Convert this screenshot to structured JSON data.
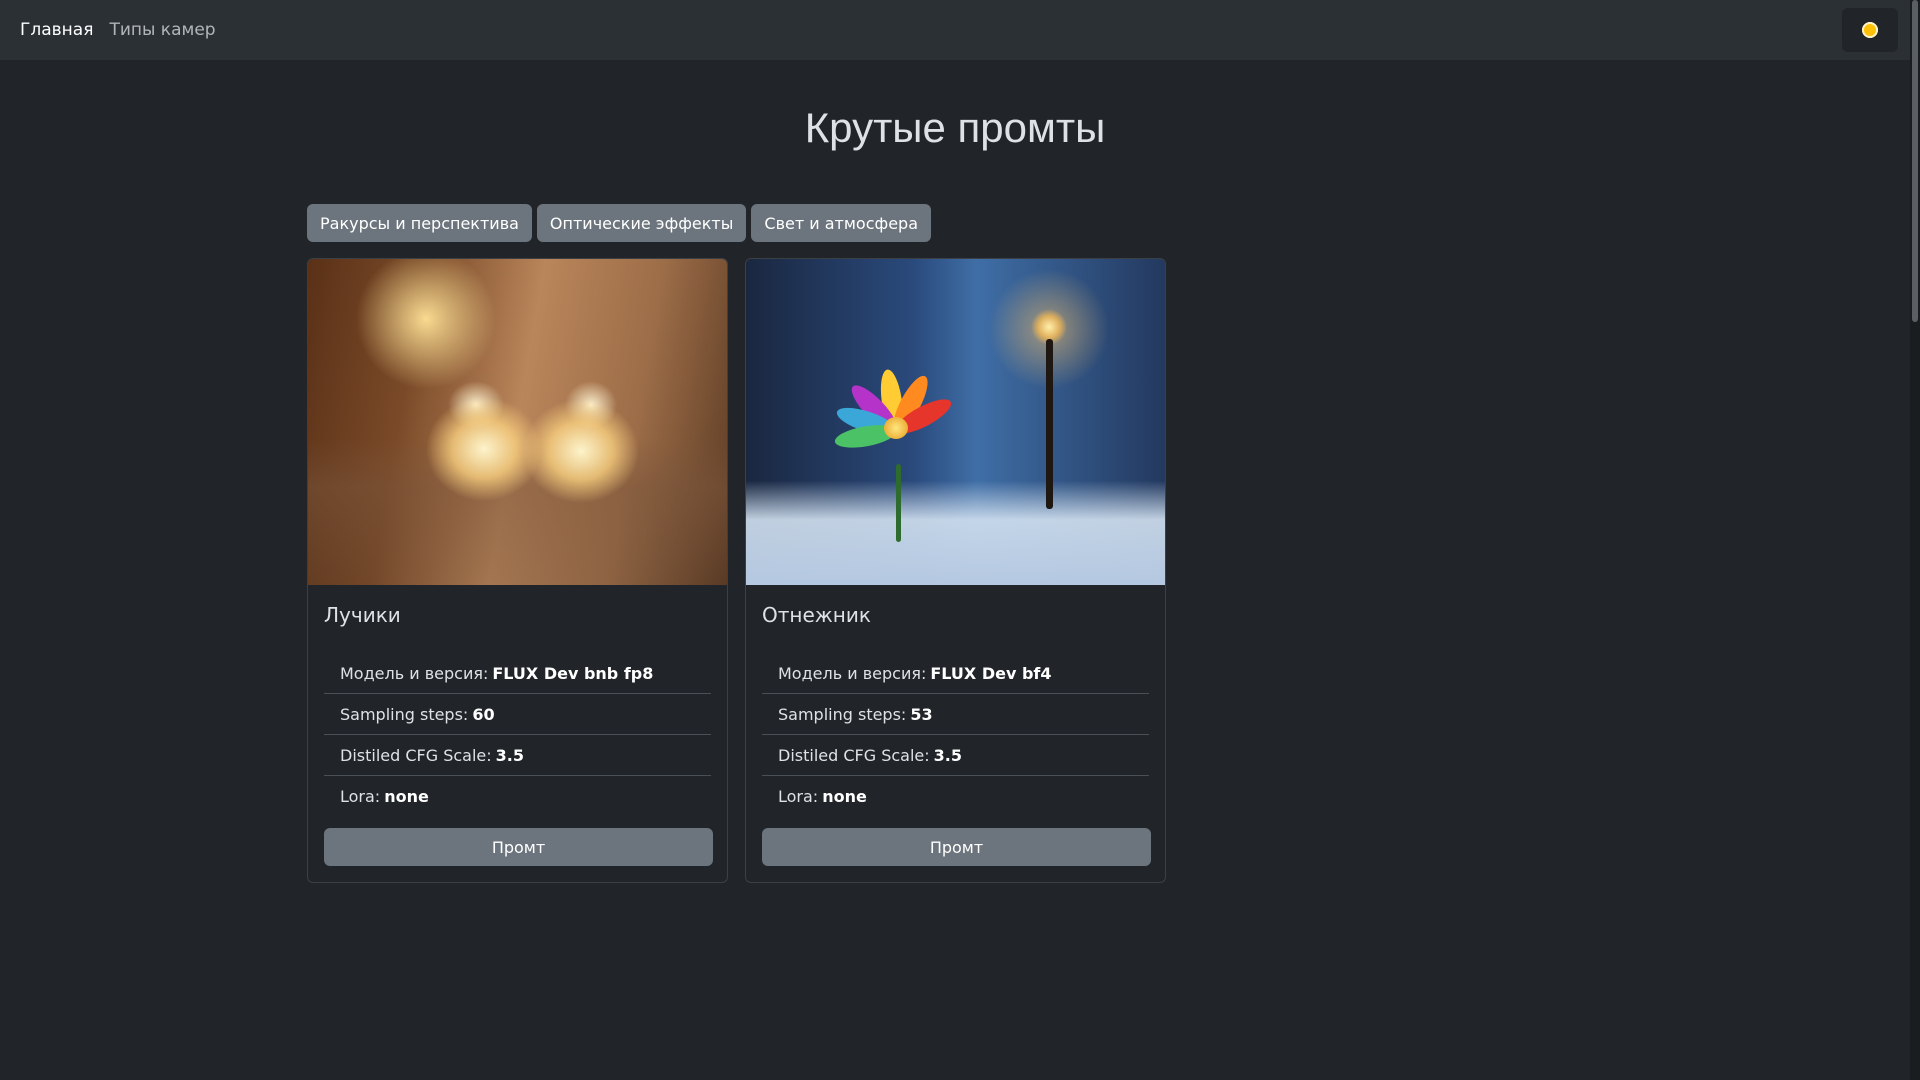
{
  "nav": {
    "home": "Главная",
    "camera_types": "Типы камер"
  },
  "title": "Крутые промты",
  "filters": [
    "Ракурсы и перспектива",
    "Оптические эффекты",
    "Свет и атмосфера"
  ],
  "cards": [
    {
      "title": "Лучики",
      "params": [
        {
          "label": "Модель и версия:",
          "value": "FLUX Dev bnb fp8"
        },
        {
          "label": "Sampling steps:",
          "value": "60"
        },
        {
          "label": "Distiled CFG Scale:",
          "value": "3.5"
        },
        {
          "label": "Lora:",
          "value": "none"
        }
      ],
      "button": "Промт"
    },
    {
      "title": "Отнежник",
      "params": [
        {
          "label": "Модель и версия:",
          "value": "FLUX Dev bf4"
        },
        {
          "label": "Sampling steps:",
          "value": "53"
        },
        {
          "label": "Distiled CFG Scale:",
          "value": "3.5"
        },
        {
          "label": "Lora:",
          "value": "none"
        }
      ],
      "button": "Промт"
    }
  ],
  "colors": {
    "background": "#212529",
    "navbar": "#2b3035",
    "button": "#6c757d",
    "theme_icon": "#ffc107"
  },
  "icons": {
    "theme_toggle": "sun-icon"
  }
}
